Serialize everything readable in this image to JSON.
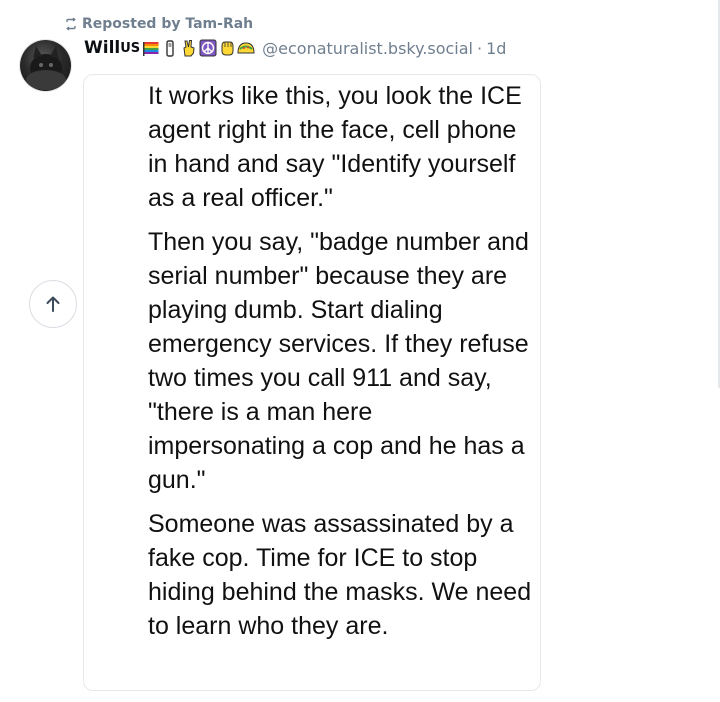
{
  "repost": {
    "icon": "repost-icon",
    "label": "Reposted by Tam-Rah"
  },
  "author": {
    "name": "Will",
    "name_suffix": "US",
    "emoji_icons": [
      "rainbow-flag-icon",
      "vape-icon",
      "peace-hand-icon",
      "peace-symbol-icon",
      "raised-fist-icon",
      "taco-icon"
    ],
    "handle": "@econaturalist.bsky.social",
    "separator": "·",
    "time": "1d"
  },
  "post_image": {
    "paragraphs": [
      "It works like this, you look the ICE agent right in the face, cell phone in hand and say \"Identify yourself as a real officer.\"",
      "Then you say, \"badge number and serial number\" because they are playing dumb. Start dialing emergency services. If they refuse two times you call 911 and say, \"there is a man here impersonating a cop and he has a gun.\"",
      "Someone was assassinated by a fake cop. Time for ICE to stop hiding behind the masks. We need to learn who they are."
    ]
  },
  "scroll_top": {
    "icon": "arrow-up-icon"
  },
  "colors": {
    "muted": "#6f7f8f",
    "text": "#0b0f14",
    "border": "#e5e8eb"
  }
}
